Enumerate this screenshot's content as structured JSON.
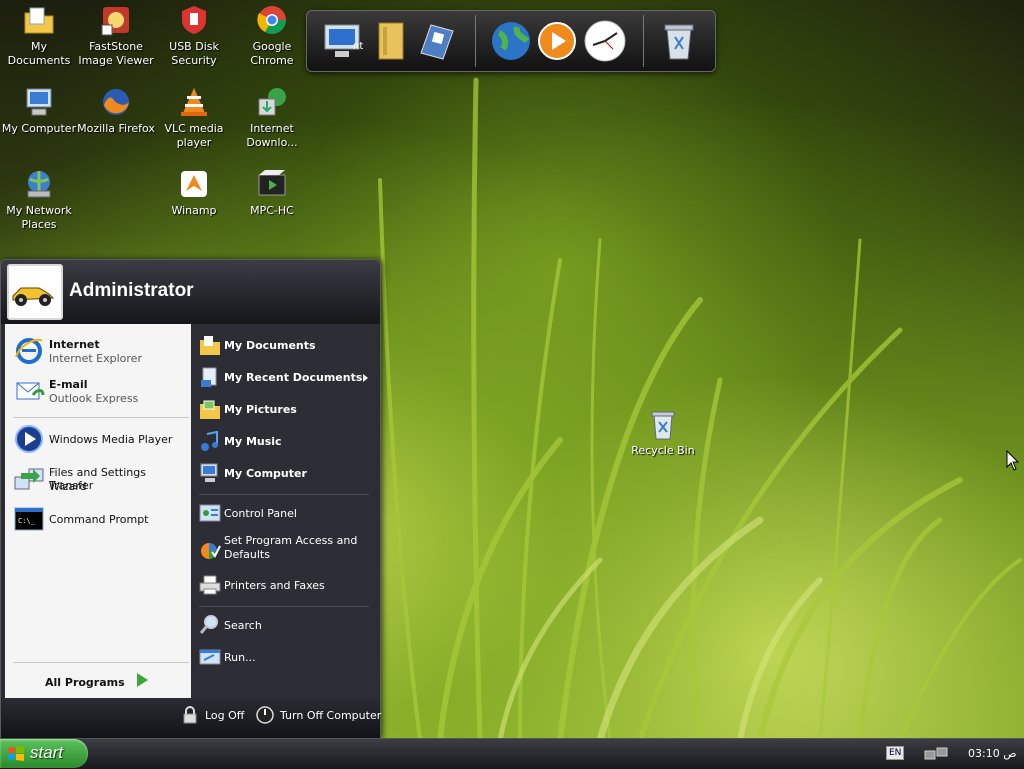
{
  "desktop": {
    "icons": [
      {
        "label": "My Documents",
        "icon": "my-documents-icon"
      },
      {
        "label": "FastStone Image Viewer",
        "icon": "faststone-icon"
      },
      {
        "label": "USB Disk Security",
        "icon": "usb-disk-security-icon"
      },
      {
        "label": "Google Chrome",
        "icon": "chrome-icon"
      },
      {
        "label": "My Computer",
        "icon": "my-computer-icon"
      },
      {
        "label": "Mozilla Firefox",
        "icon": "firefox-icon"
      },
      {
        "label": "VLC media player",
        "icon": "vlc-icon"
      },
      {
        "label": "Internet Downlo...",
        "icon": "internet-download-manager-icon"
      },
      {
        "label": "My Network Places",
        "icon": "network-places-icon"
      },
      {
        "label": "Winamp",
        "icon": "winamp-icon"
      },
      {
        "label": "MPC-HC",
        "icon": "mpc-hc-icon"
      }
    ],
    "recycle_bin": {
      "label": "Recycle Bin",
      "icon": "recycle-bin-icon"
    }
  },
  "dock": {
    "items": [
      "computer-icon",
      "folder-icon",
      "documents-icon",
      "globe-icon",
      "media-player-icon",
      "clock-icon",
      "trash-icon"
    ],
    "partial_label": "nt"
  },
  "start_menu": {
    "user": "Administrator",
    "left_items": [
      {
        "title": "Internet",
        "subtitle": "Internet Explorer",
        "icon": "internet-explorer-icon"
      },
      {
        "title": "E-mail",
        "subtitle": "Outlook Express",
        "icon": "outlook-express-icon"
      },
      {
        "title": "Windows Media Player",
        "subtitle": "",
        "icon": "windows-media-player-icon"
      },
      {
        "title": "Files and Settings Transfer",
        "subtitle": "Wizard",
        "icon": "transfer-wizard-icon"
      },
      {
        "title": "Command Prompt",
        "subtitle": "",
        "icon": "command-prompt-icon"
      }
    ],
    "all_programs": "All Programs",
    "right_items": [
      {
        "label": "My Documents",
        "icon": "my-documents-icon"
      },
      {
        "label": "My Recent Documents",
        "icon": "recent-documents-icon"
      },
      {
        "label": "My Pictures",
        "icon": "my-pictures-icon"
      },
      {
        "label": "My Music",
        "icon": "my-music-icon"
      },
      {
        "label": "My Computer",
        "icon": "my-computer-icon"
      },
      {
        "label": "Control Panel",
        "icon": "control-panel-icon"
      },
      {
        "label": "Set Program Access and Defaults",
        "icon": "program-access-icon"
      },
      {
        "label": "Printers and Faxes",
        "icon": "printers-icon"
      },
      {
        "label": "Search",
        "icon": "search-icon"
      },
      {
        "label": "Run...",
        "icon": "run-icon"
      }
    ],
    "log_off": "Log Off",
    "turn_off": "Turn Off Computer"
  },
  "taskbar": {
    "start_label": "start",
    "language": "EN",
    "clock": "03:10 ص"
  }
}
